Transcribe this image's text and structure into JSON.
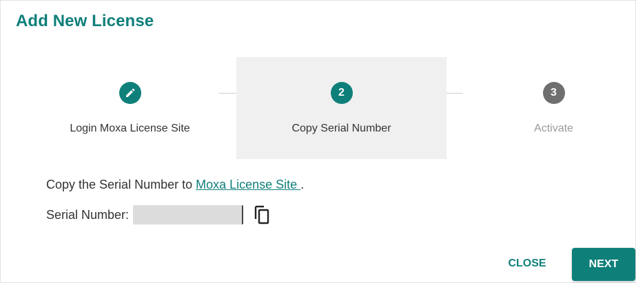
{
  "dialog": {
    "title": "Add New License"
  },
  "stepper": {
    "steps": [
      {
        "label": "Login Moxa License Site",
        "marker": "",
        "state": "done",
        "icon": "pencil-icon"
      },
      {
        "label": "Copy Serial Number",
        "marker": "2",
        "state": "current"
      },
      {
        "label": "Activate",
        "marker": "3",
        "state": "pending"
      }
    ]
  },
  "content": {
    "copy_prefix": "Copy the Serial Number to ",
    "link_label": "Moxa License Site ",
    "copy_suffix": ".",
    "serial_label": "Serial Number:",
    "serial_value": ""
  },
  "actions": {
    "close_label": "CLOSE",
    "next_label": "NEXT"
  },
  "colors": {
    "accent": "#0f7f7a",
    "pending": "#6f6f6f",
    "active_step_bg": "#f0f0f0"
  }
}
